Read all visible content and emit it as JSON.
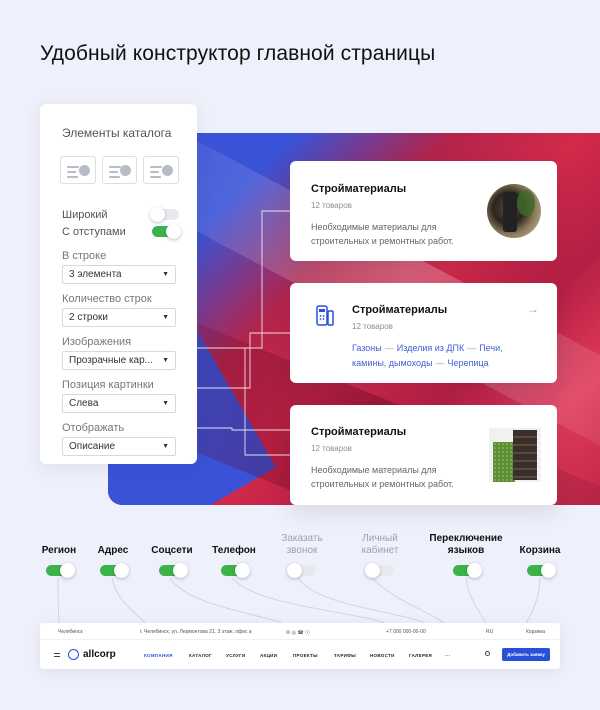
{
  "headline": "Удобный конструктор главной страницы",
  "panel": {
    "title": "Элементы каталога",
    "toggles": [
      {
        "label": "Широкий",
        "on": false
      },
      {
        "label": "С отступами",
        "on": true
      }
    ],
    "fields": [
      {
        "label": "В строке",
        "value": "3 элемента"
      },
      {
        "label": "Количество строк",
        "value": "2 строки"
      },
      {
        "label": "Изображения",
        "value": "Прозрачные кар..."
      },
      {
        "label": "Позиция картинки",
        "value": "Слева"
      },
      {
        "label": "Отображать",
        "value": "Описание"
      }
    ],
    "caret": "▼"
  },
  "cards": [
    {
      "title": "Стройматериалы",
      "count": "12 товаров",
      "desc": "Необходимые материалы для строительных и ремонтных работ."
    },
    {
      "title": "Стройматериалы",
      "count": "12 товаров",
      "arrow": "→",
      "links": [
        "Газоны",
        "Изделия из ДПК",
        "Печи, камины, дымоходы",
        "Черепица"
      ],
      "sep": "—"
    },
    {
      "title": "Стройматериалы",
      "count": "12 товаров",
      "desc": "Необходимые материалы для строительных и ремонтных работ."
    }
  ],
  "features": [
    {
      "label": "Регион",
      "on": true
    },
    {
      "label": "Адрес",
      "on": true
    },
    {
      "label": "Соцсети",
      "on": true
    },
    {
      "label": "Телефон",
      "on": true
    },
    {
      "label": "Заказать звонок",
      "on": false
    },
    {
      "label": "Личный кабинет",
      "on": false
    },
    {
      "label": "Переключение языков",
      "on": true
    },
    {
      "label": "Корзина",
      "on": true
    }
  ],
  "mini_header": {
    "region": "Челябинск",
    "address": "г. Челябинск, ул. Лермонтова 21, 3 этаж, офис а",
    "phone": "+7 000 000-00-00",
    "lang": "RU",
    "cart": "Корзина",
    "logo": "allcorp",
    "nav": [
      "КОМПАНИЯ",
      "КАТАЛОГ",
      "УСЛУГИ",
      "АКЦИИ",
      "ПРОЕКТЫ",
      "ТАРИФЫ",
      "НОВОСТИ",
      "ГАЛЕРЕЯ",
      "···"
    ],
    "cta": "Добавить заявку"
  },
  "colors": {
    "accent": "#2a4fd8",
    "toggle_on": "#3cb34a",
    "link": "#3f5ed6"
  }
}
